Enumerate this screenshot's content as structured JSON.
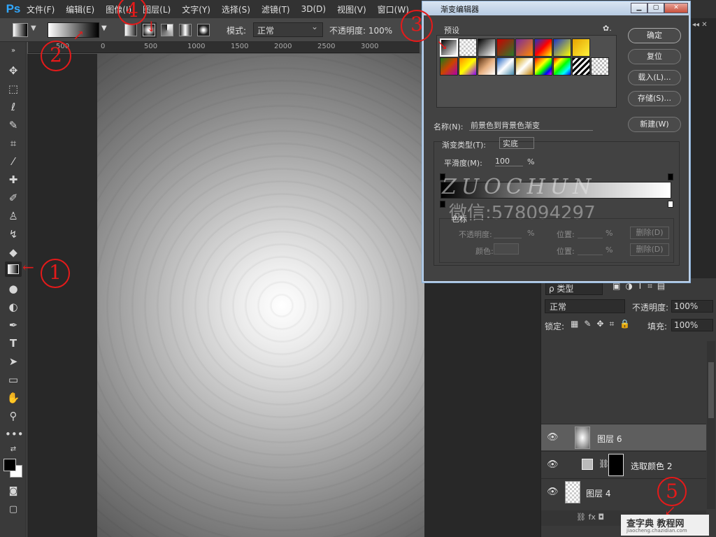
{
  "app": {
    "logo": "Ps"
  },
  "menu": [
    "文件(F)",
    "编辑(E)",
    "图像(I)",
    "图层(L)",
    "文字(Y)",
    "选择(S)",
    "滤镜(T)",
    "3D(D)",
    "视图(V)",
    "窗口(W)"
  ],
  "options": {
    "mode_label": "模式:",
    "mode_value": "正常",
    "opacity_label": "不透明度: 100%"
  },
  "ruler": [
    "500",
    "0",
    "500",
    "1000",
    "1500",
    "2000",
    "2500",
    "3000"
  ],
  "gradient_editor": {
    "title": "渐变编辑器",
    "presets_label": "预设",
    "buttons": [
      "确定",
      "复位",
      "载入(L)...",
      "存储(S)..."
    ],
    "new_button": "新建(W)",
    "name_label": "名称(N):",
    "name_value": "前景色到背景色渐变",
    "type_label": "渐变类型(T):",
    "type_value": "实底",
    "smoothness_label": "平滑度(M):",
    "smoothness_value": "100",
    "percent": "%",
    "stops_label": "色标",
    "stop_opacity_label": "不透明度:",
    "stop_color_label": "颜色:",
    "location_label": "位置:",
    "delete_button": "删除(D)",
    "watermark": "ZUOCHUN",
    "watermark2": "微信:578094297"
  },
  "layers": {
    "filter_label": "ρ 类型",
    "blend_mode": "正常",
    "opacity_label": "不透明度:",
    "opacity_value": "100%",
    "lock_label": "锁定:",
    "fill_label": "填充:",
    "fill_value": "100%",
    "items": [
      {
        "name": "图层 6"
      },
      {
        "name": "选取颜色 2"
      },
      {
        "name": "图层 4"
      }
    ],
    "footer": "fx"
  },
  "annotations": [
    "1",
    "2",
    "3",
    "4",
    "5"
  ],
  "site_badge": {
    "text": "查字典 教程网",
    "url": "jiaocheng.chazidian.com"
  }
}
